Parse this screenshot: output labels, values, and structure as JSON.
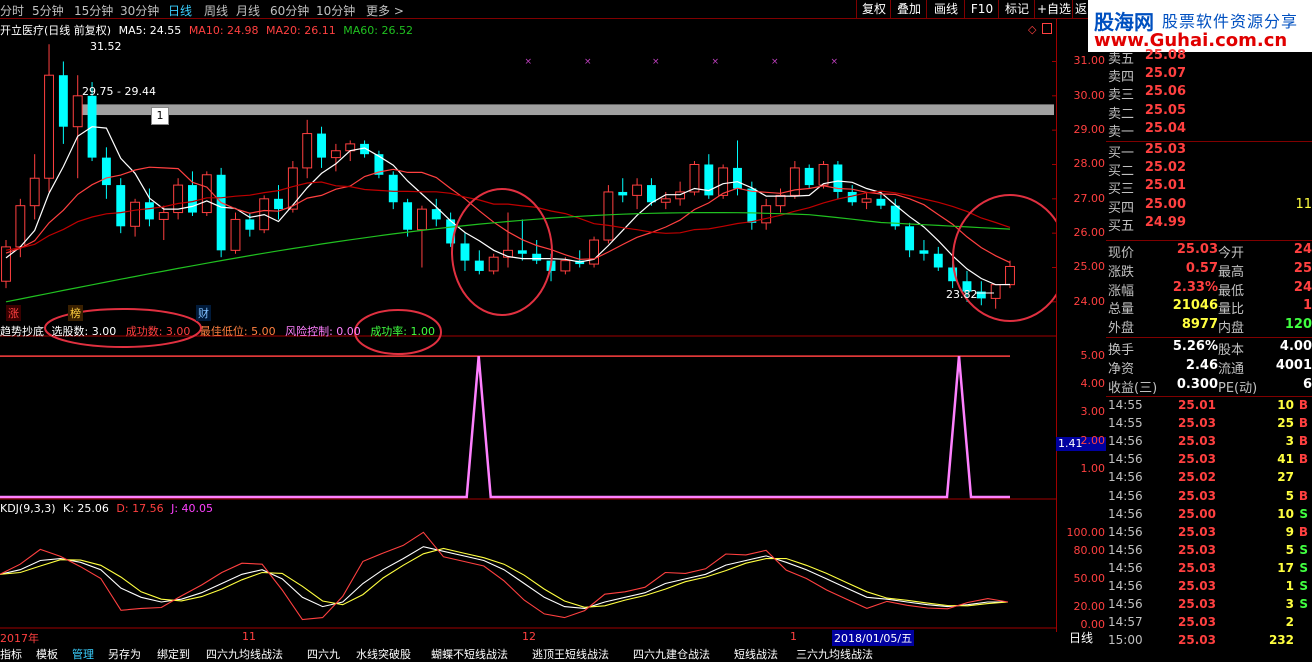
{
  "period_tabs": [
    {
      "label": "分时",
      "active": false
    },
    {
      "label": "5分钟",
      "active": false
    },
    {
      "label": "15分钟",
      "active": false
    },
    {
      "label": "30分钟",
      "active": false
    },
    {
      "label": "日线",
      "active": true
    },
    {
      "label": "周线",
      "active": false
    },
    {
      "label": "月线",
      "active": false
    },
    {
      "label": "60分钟",
      "active": false
    },
    {
      "label": "10分钟",
      "active": false
    },
    {
      "label": "更多 >",
      "active": false
    }
  ],
  "toolbar_buttons": [
    "复权",
    "叠加",
    "画线",
    "F10",
    "标记",
    "+自选",
    "返"
  ],
  "logo": {
    "brand": "股海网",
    "slogan": "股票软件资源分享",
    "url": "www.Guhai.com.cn"
  },
  "chart_header": {
    "stock": "开立医疗(日线 前复权)",
    "ma5": "MA5: 24.55",
    "ma10": "MA10: 24.98",
    "ma20": "MA20: 26.11",
    "ma60": "MA60: 26.52"
  },
  "annotations": {
    "high_label": "31.52",
    "range_label": "29.75 - 29.44",
    "box_label": "1",
    "low_label": "23.82"
  },
  "event_markers": [
    "涨",
    "榜",
    "财"
  ],
  "indicator_header": {
    "name": "趋势抄底",
    "p1": "选股数: 3.00",
    "p2": "成功数: 3.00",
    "p3": "最佳低位: 5.00",
    "p4": "风险控制: 0.00",
    "p5": "成功率: 1.00"
  },
  "kdj_header": {
    "name": "KDJ(9,3,3)",
    "k": "K: 25.06",
    "d": "D: 17.56",
    "j": "J: 40.05"
  },
  "price_axis": [
    "31.00",
    "30.00",
    "29.00",
    "28.00",
    "27.00",
    "26.00",
    "25.00",
    "24.00"
  ],
  "ind_axis": [
    "5.00",
    "4.00",
    "3.00",
    "2.00",
    "1.00"
  ],
  "ind_value_box": "1.41",
  "kdj_axis": [
    "100.00",
    "80.00",
    "50.00",
    "20.00",
    "0.00"
  ],
  "date_axis": [
    "2017年",
    "11",
    "12",
    "1",
    "2018/01/05/五"
  ],
  "period_label": "日线",
  "order_book": [
    {
      "label": "卖五",
      "price": "25.08"
    },
    {
      "label": "卖四",
      "price": "25.07"
    },
    {
      "label": "卖三",
      "price": "25.06"
    },
    {
      "label": "卖二",
      "price": "25.05"
    },
    {
      "label": "卖一",
      "price": "25.04"
    },
    {
      "label": "买一",
      "price": "25.03"
    },
    {
      "label": "买二",
      "price": "25.02"
    },
    {
      "label": "买三",
      "price": "25.01"
    },
    {
      "label": "买四",
      "price": "25.00",
      "vol": "11"
    },
    {
      "label": "买五",
      "price": "24.99"
    }
  ],
  "quote_stats": [
    {
      "l1": "现价",
      "v1": "25.03",
      "l2": "今开",
      "v2": "24"
    },
    {
      "l1": "涨跌",
      "v1": "0.57",
      "l2": "最高",
      "v2": "25"
    },
    {
      "l1": "涨幅",
      "v1": "2.33%",
      "l2": "最低",
      "v2": "24"
    },
    {
      "l1": "总量",
      "v1": "21046",
      "l2": "量比",
      "v2": "1"
    },
    {
      "l1": "外盘",
      "v1": "8977",
      "l2": "内盘",
      "v2": "120"
    },
    {
      "l1": "换手",
      "v1": "5.26%",
      "l2": "股本",
      "v2": "4.00"
    },
    {
      "l1": "净资",
      "v1": "2.46",
      "l2": "流通",
      "v2": "4001"
    },
    {
      "l1": "收益(三)",
      "v1": "0.300",
      "l2": "PE(动)",
      "v2": "6"
    }
  ],
  "ticks": [
    {
      "t": "14:55",
      "p": "25.01",
      "v": "10",
      "s": "B"
    },
    {
      "t": "14:55",
      "p": "25.03",
      "v": "25",
      "s": "B"
    },
    {
      "t": "14:56",
      "p": "25.03",
      "v": "3",
      "s": "B"
    },
    {
      "t": "14:56",
      "p": "25.03",
      "v": "41",
      "s": "B"
    },
    {
      "t": "14:56",
      "p": "25.02",
      "v": "27",
      "s": ""
    },
    {
      "t": "14:56",
      "p": "25.03",
      "v": "5",
      "s": "B"
    },
    {
      "t": "14:56",
      "p": "25.00",
      "v": "10",
      "s": "S"
    },
    {
      "t": "14:56",
      "p": "25.03",
      "v": "9",
      "s": "B"
    },
    {
      "t": "14:56",
      "p": "25.03",
      "v": "5",
      "s": "S"
    },
    {
      "t": "14:56",
      "p": "25.03",
      "v": "17",
      "s": "S"
    },
    {
      "t": "14:56",
      "p": "25.03",
      "v": "1",
      "s": "S"
    },
    {
      "t": "14:56",
      "p": "25.03",
      "v": "3",
      "s": "S"
    },
    {
      "t": "14:57",
      "p": "25.03",
      "v": "2",
      "s": ""
    },
    {
      "t": "15:00",
      "p": "25.03",
      "v": "232",
      "s": ""
    }
  ],
  "bottom_tabs": [
    "指标",
    "模板",
    "管理",
    "另存为",
    "绑定到",
    "四六九均线战法",
    "四六九",
    "水线突破股",
    "蝴蝶不短线战法",
    "逃顶王短线战法",
    "四六九建仓战法",
    "短线战法",
    "三六九均线战法"
  ],
  "colors": {
    "up": "#ff4040",
    "down": "#00ffff",
    "ma5": "#ffffff",
    "ma10": "#ff4040",
    "ma20": "#c00000",
    "ma60": "#20c020",
    "signal": "#ff80ff",
    "highlight": "#e03040"
  },
  "chart_data": {
    "type": "candlestick",
    "ylim": [
      23.5,
      31.8
    ],
    "candles": [
      [
        24.6,
        25.8,
        24.4,
        25.6
      ],
      [
        25.6,
        27.0,
        25.3,
        26.8
      ],
      [
        26.8,
        28.3,
        26.4,
        27.6
      ],
      [
        27.6,
        31.5,
        27.2,
        30.6
      ],
      [
        30.6,
        31.0,
        28.6,
        29.1
      ],
      [
        29.1,
        30.6,
        27.6,
        30.0
      ],
      [
        30.0,
        30.4,
        28.1,
        28.2
      ],
      [
        28.2,
        28.5,
        27.0,
        27.4
      ],
      [
        27.4,
        27.6,
        26.0,
        26.2
      ],
      [
        26.2,
        27.0,
        25.9,
        26.9
      ],
      [
        26.9,
        27.3,
        26.2,
        26.4
      ],
      [
        26.4,
        26.8,
        25.8,
        26.6
      ],
      [
        26.6,
        27.6,
        26.4,
        27.4
      ],
      [
        27.4,
        27.8,
        26.5,
        26.6
      ],
      [
        26.6,
        27.8,
        26.5,
        27.7
      ],
      [
        27.7,
        27.9,
        25.3,
        25.5
      ],
      [
        25.5,
        26.6,
        25.4,
        26.4
      ],
      [
        26.4,
        26.6,
        25.9,
        26.1
      ],
      [
        26.1,
        27.1,
        26.0,
        27.0
      ],
      [
        27.0,
        27.4,
        26.4,
        26.7
      ],
      [
        26.7,
        28.1,
        26.6,
        27.9
      ],
      [
        27.9,
        29.3,
        27.6,
        28.9
      ],
      [
        28.9,
        29.1,
        27.9,
        28.2
      ],
      [
        28.2,
        28.6,
        27.8,
        28.4
      ],
      [
        28.4,
        28.7,
        28.1,
        28.6
      ],
      [
        28.6,
        28.7,
        28.2,
        28.3
      ],
      [
        28.3,
        28.4,
        27.6,
        27.7
      ],
      [
        27.7,
        27.8,
        26.7,
        26.9
      ],
      [
        26.9,
        27.0,
        25.9,
        26.1
      ],
      [
        26.1,
        26.8,
        25.0,
        26.7
      ],
      [
        26.7,
        27.0,
        26.2,
        26.4
      ],
      [
        26.4,
        26.6,
        25.6,
        25.7
      ],
      [
        25.7,
        26.0,
        24.9,
        25.2
      ],
      [
        25.2,
        25.5,
        24.8,
        24.9
      ],
      [
        24.9,
        25.4,
        24.8,
        25.3
      ],
      [
        25.3,
        26.6,
        25.0,
        25.5
      ],
      [
        25.5,
        26.4,
        25.2,
        25.4
      ],
      [
        25.4,
        25.8,
        25.1,
        25.2
      ],
      [
        25.2,
        25.4,
        24.6,
        24.9
      ],
      [
        24.9,
        25.3,
        24.8,
        25.2
      ],
      [
        25.2,
        25.5,
        25.0,
        25.1
      ],
      [
        25.1,
        25.9,
        25.0,
        25.8
      ],
      [
        25.8,
        27.4,
        25.7,
        27.2
      ],
      [
        27.2,
        27.6,
        26.9,
        27.1
      ],
      [
        27.1,
        27.6,
        26.7,
        27.4
      ],
      [
        27.4,
        27.6,
        26.8,
        26.9
      ],
      [
        26.9,
        27.2,
        26.7,
        27.0
      ],
      [
        27.0,
        27.5,
        26.8,
        27.2
      ],
      [
        27.2,
        28.1,
        27.1,
        28.0
      ],
      [
        28.0,
        28.3,
        27.0,
        27.1
      ],
      [
        27.1,
        28.0,
        27.0,
        27.9
      ],
      [
        27.9,
        28.7,
        27.1,
        27.3
      ],
      [
        27.3,
        27.5,
        26.1,
        26.3
      ],
      [
        26.3,
        27.0,
        26.1,
        26.8
      ],
      [
        26.8,
        27.3,
        26.6,
        27.1
      ],
      [
        27.1,
        28.1,
        27.0,
        27.9
      ],
      [
        27.9,
        28.0,
        27.3,
        27.4
      ],
      [
        27.4,
        28.1,
        27.3,
        28.0
      ],
      [
        28.0,
        28.1,
        27.0,
        27.2
      ],
      [
        27.2,
        27.4,
        26.8,
        26.9
      ],
      [
        26.9,
        27.2,
        26.7,
        27.0
      ],
      [
        27.0,
        27.2,
        26.7,
        26.8
      ],
      [
        26.8,
        27.0,
        26.1,
        26.2
      ],
      [
        26.2,
        26.3,
        25.3,
        25.5
      ],
      [
        25.5,
        25.8,
        25.2,
        25.4
      ],
      [
        25.4,
        25.6,
        24.9,
        25.0
      ],
      [
        25.0,
        25.2,
        24.4,
        24.6
      ],
      [
        24.6,
        24.9,
        24.0,
        24.3
      ],
      [
        24.3,
        24.6,
        23.9,
        24.1
      ],
      [
        24.1,
        24.5,
        23.8,
        24.5
      ],
      [
        24.5,
        25.2,
        24.4,
        25.03
      ]
    ],
    "signal_peaks_at": [
      37,
      67
    ],
    "signal_level": 5.0,
    "signal_base": 0.0
  }
}
